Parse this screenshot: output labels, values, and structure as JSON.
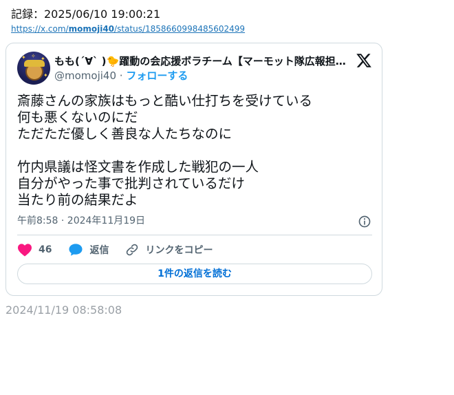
{
  "header": {
    "record_text": "記録：2025/06/10 19:00:21",
    "link_prefix": "https://x.com/",
    "link_user": "momoji40",
    "link_suffix": "/status/1858660998485602499"
  },
  "tweet": {
    "display_name": "もも(ˊ∀ˋ )🐤躍動の会応援ボラチーム【マーモット隊広報担当】",
    "handle": "@momoji40",
    "separator": "·",
    "follow_label": "フォローする",
    "text": "斎藤さんの家族はもっと酷い仕打ちを受けている\n何も悪くないのにだ\nただただ優しく善良な人たちなのに\n\n竹内県議は怪文書を作成した戦犯の一人\n自分がやった事で批判されているだけ\n当たり前の結果だよ",
    "timestamp": "午前8:58 · 2024年11月19日",
    "likes_count": "46",
    "reply_label": "返信",
    "copy_link_label": "リンクをコピー",
    "read_replies_label": "1件の返信を読む"
  },
  "footer": {
    "capture_time": "2024/11/19 08:58:08"
  },
  "colors": {
    "like": "#f91880",
    "reply": "#1d9bf0",
    "link": "#006fd6",
    "muted": "#536471"
  },
  "icons": [
    "x-logo-icon",
    "info-icon",
    "heart-icon",
    "reply-bubble-icon",
    "link-icon"
  ]
}
